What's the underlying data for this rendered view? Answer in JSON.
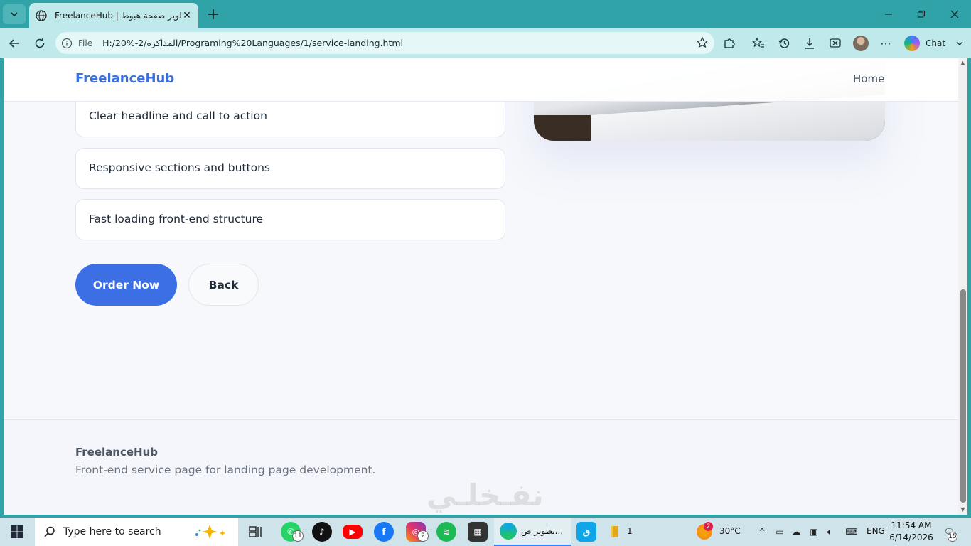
{
  "browser": {
    "tab_title": "FreelanceHub | تطوير صفحة هبوط",
    "url_scheme": "File",
    "url": "H:/20%-2/المذاكره/Programing%20Languages/1/service-landing.html",
    "chat_label": "Chat"
  },
  "site": {
    "brand": "FreelanceHub",
    "nav_home": "Home",
    "features": [
      "Clear headline and call to action",
      "Responsive sections and buttons",
      "Fast loading front-end structure"
    ],
    "order_button": "Order Now",
    "back_button": "Back",
    "footer_brand": "FreelanceHub",
    "footer_text": "Front-end service page for landing page development."
  },
  "watermark": "نفـخلـي",
  "taskbar": {
    "search_placeholder": "Type here to search",
    "whatsapp_badge": "11",
    "instagram_badge": "2",
    "active_window_label": "تطوير ص...",
    "explorer_label": "1",
    "weather_badge": "2",
    "temperature": "30°C",
    "language": "ENG",
    "time": "11:54 AM",
    "date": "6/14/2026",
    "notifications": "15"
  },
  "colors": {
    "accent": "#3b6fe3",
    "browser_frame": "#2fa3a8",
    "toolbar": "#bfe9ea"
  }
}
